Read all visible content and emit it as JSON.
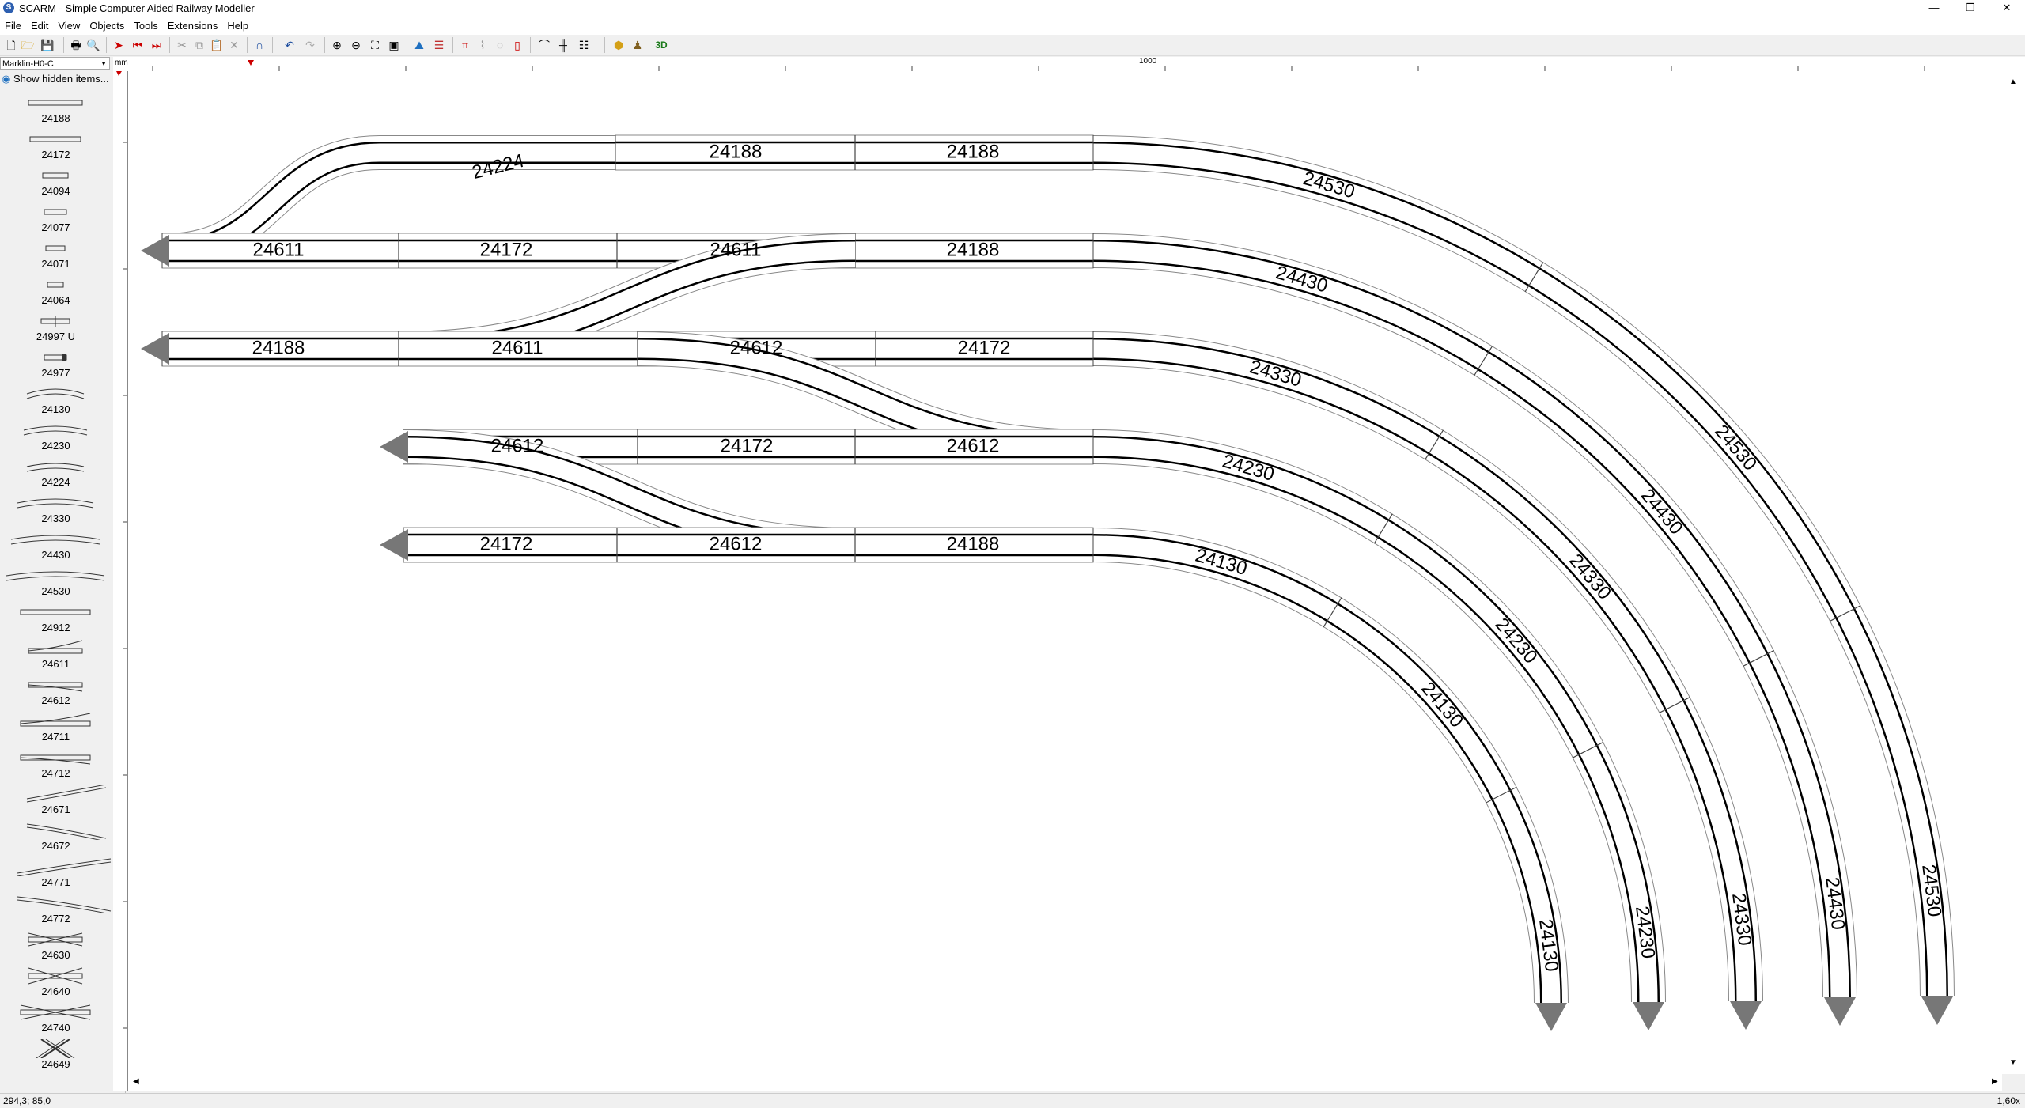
{
  "window": {
    "title": "SCARM - Simple Computer Aided Railway Modeller",
    "app_icon_letter": "S",
    "minimize": "—",
    "restore": "❐",
    "close": "✕"
  },
  "menu": [
    "File",
    "Edit",
    "View",
    "Objects",
    "Tools",
    "Extensions",
    "Help"
  ],
  "library": {
    "selected": "Marklin-H0-C",
    "show_hidden": "Show hidden items...",
    "items": [
      "24188",
      "24172",
      "24094",
      "24077",
      "24071",
      "24064",
      "24997 U",
      "24977",
      "24130",
      "24230",
      "24224",
      "24330",
      "24430",
      "24530",
      "24912",
      "24611",
      "24612",
      "24711",
      "24712",
      "24671",
      "24672",
      "24771",
      "24772",
      "24630",
      "24640",
      "24740",
      "24649"
    ]
  },
  "ruler": {
    "unit": "mm",
    "mark": "1000"
  },
  "tracks": {
    "straight_rows": [
      {
        "labels": [
          "24188",
          "24188"
        ]
      },
      {
        "labels": [
          "24611",
          "24172",
          "24611",
          "24188"
        ]
      },
      {
        "labels": [
          "24188",
          "24611",
          "24612",
          "24172"
        ]
      },
      {
        "labels": [
          "24612",
          "24172",
          "24612"
        ]
      },
      {
        "labels": [
          "24172",
          "24612",
          "24188"
        ]
      }
    ],
    "curve_top": "24224",
    "curve_labels": [
      "24530",
      "24430",
      "24330",
      "24230",
      "24130"
    ]
  },
  "status": {
    "coords": "294,3; 85,0",
    "zoom": "1,60x"
  }
}
